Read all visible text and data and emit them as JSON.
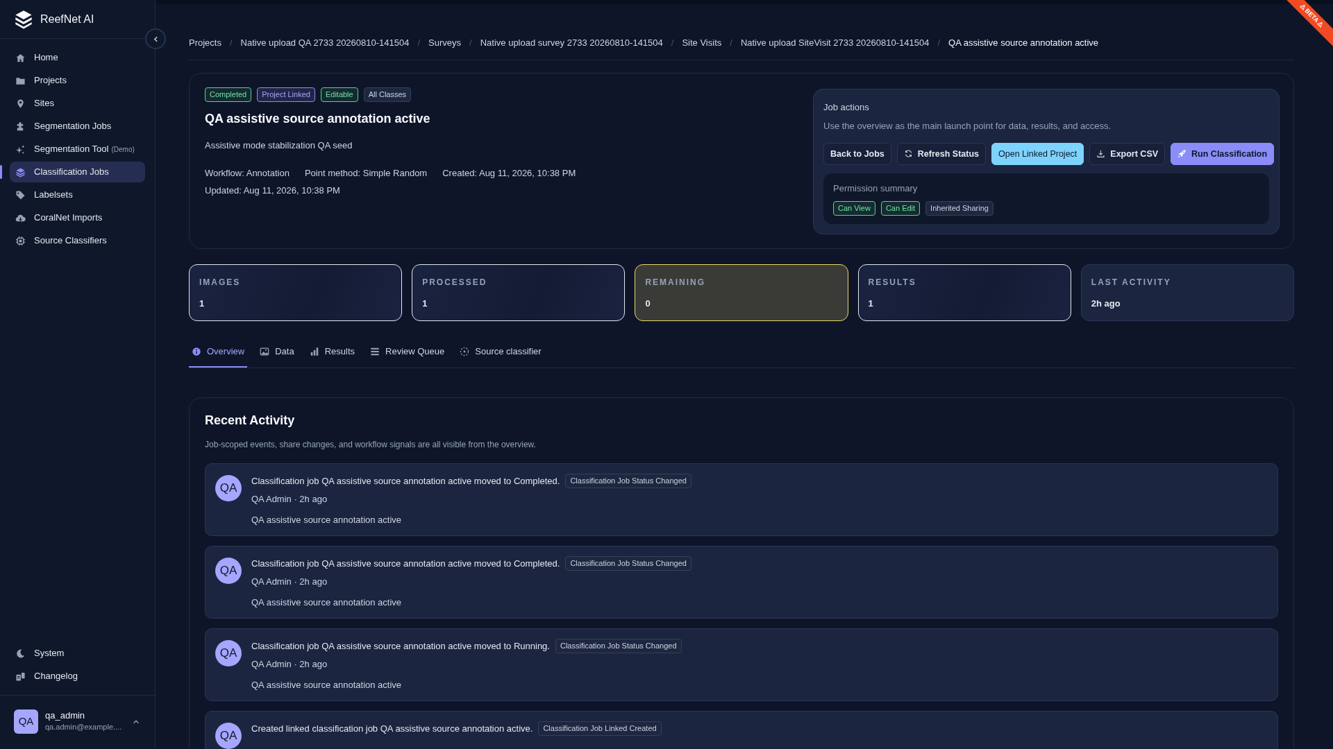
{
  "brand": {
    "name": "ReefNet AI"
  },
  "sidebar": {
    "items": [
      {
        "label": "Home",
        "selected": false
      },
      {
        "label": "Projects",
        "selected": false
      },
      {
        "label": "Sites",
        "selected": false
      },
      {
        "label": "Segmentation Jobs",
        "selected": false
      },
      {
        "label": "Segmentation Tool",
        "tag": "(Demo)",
        "selected": false
      },
      {
        "label": "Classification Jobs",
        "selected": true
      },
      {
        "label": "Labelsets",
        "selected": false
      },
      {
        "label": "CoralNet Imports",
        "selected": false
      },
      {
        "label": "Source Classifiers",
        "selected": false
      }
    ],
    "footer_items": [
      {
        "label": "System"
      },
      {
        "label": "Changelog"
      }
    ],
    "user": {
      "avatar": "QA",
      "name": "qa_admin",
      "email": "qa.admin@example...."
    }
  },
  "beta_ribbon": "⚠ BETA ⚠",
  "breadcrumb_separator": "/",
  "breadcrumb": [
    "Projects",
    "Native upload QA 2733 20260810-141504",
    "Surveys",
    "Native upload survey 2733 20260810-141504",
    "Site Visits",
    "Native upload SiteVisit 2733 20260810-141504",
    "QA assistive source annotation active"
  ],
  "job": {
    "badges": [
      {
        "label": "Completed",
        "kind": "success"
      },
      {
        "label": "Project Linked",
        "kind": "primary"
      },
      {
        "label": "Editable",
        "kind": "success"
      },
      {
        "label": "All Classes",
        "kind": "neutral"
      }
    ],
    "title": "QA assistive source annotation active",
    "description": "Assistive mode stabilization QA seed",
    "meta": [
      "Workflow: Annotation",
      "Point method: Simple Random",
      "Created: Aug 11, 2026, 10:38 PM",
      "Updated: Aug 11, 2026, 10:38 PM"
    ]
  },
  "job_actions": {
    "title": "Job actions",
    "description": "Use the overview as the main launch point for data, results, and access.",
    "buttons": [
      {
        "label": "Back to Jobs",
        "kind": "outline"
      },
      {
        "label": "Refresh Status",
        "kind": "outline"
      },
      {
        "label": "Open Linked Project",
        "kind": "info"
      },
      {
        "label": "Export CSV",
        "kind": "outline"
      },
      {
        "label": "Run Classification",
        "kind": "primary"
      }
    ],
    "permissions": {
      "title": "Permission summary",
      "badges": [
        {
          "label": "Can View",
          "kind": "success"
        },
        {
          "label": "Can Edit",
          "kind": "success"
        },
        {
          "label": "Inherited Sharing",
          "kind": "neutral"
        }
      ]
    }
  },
  "stats": [
    {
      "label": "IMAGES",
      "value": "1",
      "kind": "outlined"
    },
    {
      "label": "PROCESSED",
      "value": "1",
      "kind": "outlined"
    },
    {
      "label": "REMAINING",
      "value": "0",
      "kind": "warning"
    },
    {
      "label": "RESULTS",
      "value": "1",
      "kind": "outlined"
    },
    {
      "label": "LAST ACTIVITY",
      "value": "2h ago",
      "kind": "plain"
    }
  ],
  "tabs": [
    {
      "label": "Overview",
      "selected": true
    },
    {
      "label": "Data",
      "selected": false
    },
    {
      "label": "Results",
      "selected": false
    },
    {
      "label": "Review Queue",
      "selected": false
    },
    {
      "label": "Source classifier",
      "selected": false
    }
  ],
  "activity": {
    "title": "Recent Activity",
    "description": "Job-scoped events, share changes, and workflow signals are all visible from the overview.",
    "items": [
      {
        "avatar": "QA",
        "message": "Classification job QA assistive source annotation active moved to Completed.",
        "badge": "Classification Job Status Changed",
        "meta": "QA Admin · 2h ago",
        "detail": "QA assistive source annotation active"
      },
      {
        "avatar": "QA",
        "message": "Classification job QA assistive source annotation active moved to Completed.",
        "badge": "Classification Job Status Changed",
        "meta": "QA Admin · 2h ago",
        "detail": "QA assistive source annotation active"
      },
      {
        "avatar": "QA",
        "message": "Classification job QA assistive source annotation active moved to Running.",
        "badge": "Classification Job Status Changed",
        "meta": "QA Admin · 2h ago",
        "detail": "QA assistive source annotation active"
      },
      {
        "avatar": "QA",
        "message": "Created linked classification job QA assistive source annotation active.",
        "badge": "Classification Job Linked Created"
      }
    ]
  }
}
